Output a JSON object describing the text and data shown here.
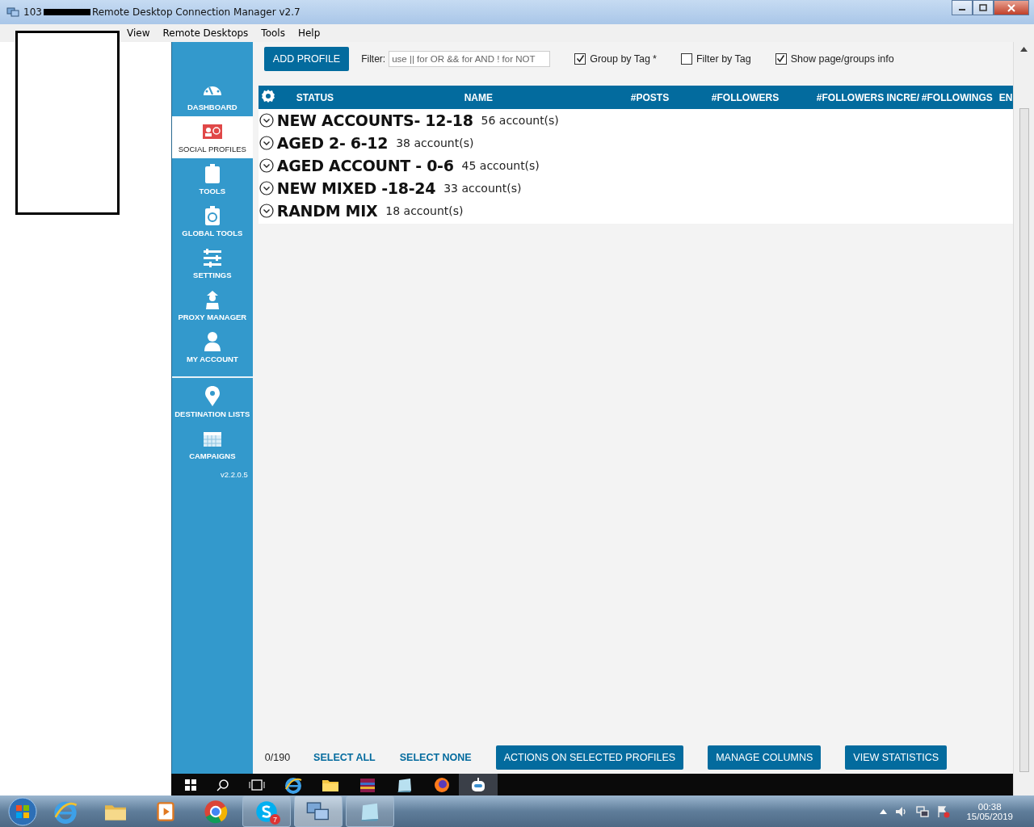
{
  "window": {
    "title_prefix": "103",
    "title": "Remote Desktop Connection Manager v2.7"
  },
  "menu": [
    "View",
    "Remote Desktops",
    "Tools",
    "Help"
  ],
  "sidebar": {
    "sections": [
      {
        "items": [
          {
            "label": "DASHBOARD",
            "selected": false
          },
          {
            "label": "SOCIAL PROFILES",
            "selected": true
          },
          {
            "label": "TOOLS",
            "selected": false
          },
          {
            "label": "GLOBAL TOOLS",
            "selected": false
          },
          {
            "label": "SETTINGS",
            "selected": false
          },
          {
            "label": "PROXY MANAGER",
            "selected": false
          },
          {
            "label": "MY ACCOUNT",
            "selected": false
          }
        ]
      },
      {
        "items": [
          {
            "label": "DESTINATION LISTS",
            "selected": false
          },
          {
            "label": "CAMPAIGNS",
            "selected": false
          }
        ]
      }
    ],
    "version": "v2.2.0.5"
  },
  "toolbar": {
    "add_button": "ADD PROFILE",
    "filter_label": "Filter:",
    "filter_placeholder": "use || for OR && for AND ! for NOT",
    "options": [
      {
        "label": "Group by Tag",
        "suffix": "*",
        "checked": true
      },
      {
        "label": "Filter by Tag",
        "checked": false
      },
      {
        "label": "Show page/groups info",
        "checked": true
      }
    ]
  },
  "table": {
    "columns": [
      "STATUS",
      "NAME",
      "#POSTS",
      "#FOLLOWERS",
      "#FOLLOWERS INCRE/",
      "#FOLLOWINGS",
      "EN"
    ],
    "groups": [
      {
        "name": "NEW ACCOUNTS- 12-18",
        "count": "56 account(s)",
        "expanded": false
      },
      {
        "name": "AGED 2- 6-12",
        "count": "38 account(s)",
        "expanded": false
      },
      {
        "name": "AGED ACCOUNT - 0-6",
        "count": "45 account(s)",
        "expanded": false
      },
      {
        "name": "NEW MIXED -18-24",
        "count": "33 account(s)",
        "expanded": false
      },
      {
        "name": "RANDM MIX",
        "count": "18 account(s)",
        "expanded": false
      }
    ]
  },
  "footer": {
    "selection_count": "0/190",
    "links": [
      "SELECT ALL",
      "SELECT NONE"
    ],
    "buttons": [
      "ACTIONS ON SELECTED PROFILES",
      "MANAGE COLUMNS",
      "VIEW STATISTICS"
    ]
  },
  "taskbar": {
    "skype_badge": "7",
    "clock_time": "00:38",
    "clock_date": "15/05/2019"
  }
}
